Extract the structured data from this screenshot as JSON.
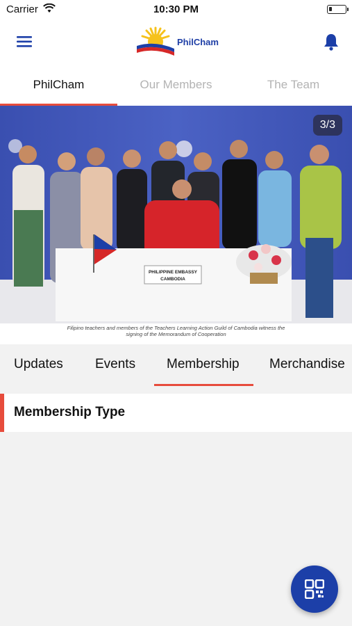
{
  "status_bar": {
    "carrier": "Carrier",
    "time": "10:30 PM",
    "battery_level": 0.2
  },
  "header": {
    "app_name": "PhilCham",
    "menu_icon": "menu-icon",
    "bell_icon": "bell-icon"
  },
  "top_tabs": [
    {
      "label": "PhilCham",
      "active": true
    },
    {
      "label": "Our Members",
      "active": false
    },
    {
      "label": "The Team",
      "active": false
    }
  ],
  "banner": {
    "counter": "3/3",
    "sign_text_1": "PHILIPPINE EMBASSY",
    "sign_text_2": "CAMBODIA",
    "caption_line_1": "Filipino teachers and members of the Teachers Learning Action Guild of Cambodia witness the",
    "caption_line_2": "signing of the Memorandum of Cooperation"
  },
  "section_tabs": [
    {
      "label": "Updates",
      "active": false
    },
    {
      "label": "Events",
      "active": false
    },
    {
      "label": "Membership",
      "active": true
    },
    {
      "label": "Merchandise",
      "active": false
    }
  ],
  "membership": {
    "title": "Membership Type"
  },
  "fab": {
    "icon": "qr-code-icon"
  },
  "colors": {
    "accent": "#e74c3c",
    "brand_blue": "#1c3fa8"
  }
}
